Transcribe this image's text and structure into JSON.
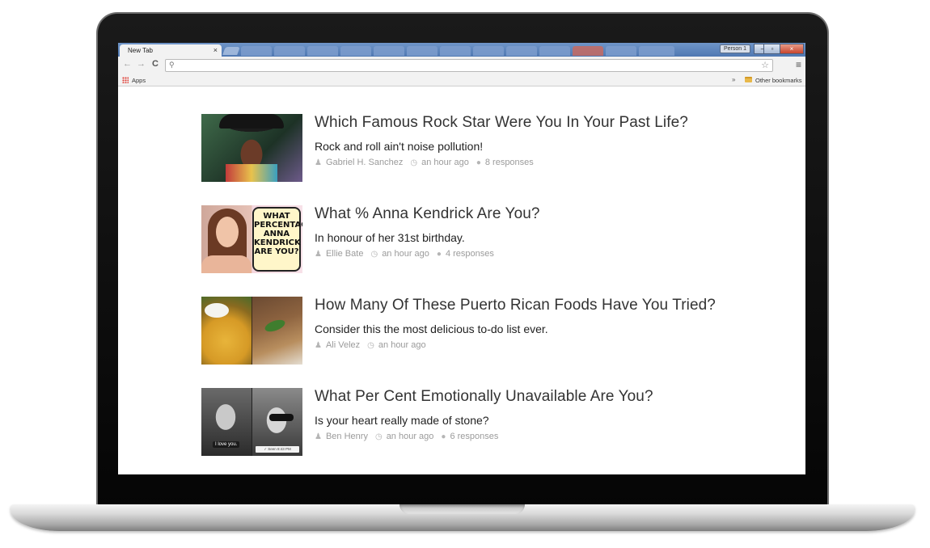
{
  "browser": {
    "active_tab_title": "New Tab",
    "tab_close_glyph": "×",
    "profile_button": "Person 1",
    "bookmarks": {
      "apps_label": "Apps",
      "overflow_glyph": "»",
      "other_bookmarks_label": "Other bookmarks"
    },
    "window_controls": {
      "minimize": "–",
      "restore": "▫",
      "close": "×"
    },
    "nav": {
      "back": "←",
      "forward": "→",
      "reload": "C",
      "menu": "≡",
      "search": "⚲",
      "star": "☆"
    }
  },
  "articles": [
    {
      "title": "Which Famous Rock Star Were You In Your Past Life?",
      "description": "Rock and roll ain't noise pollution!",
      "author": "Gabriel H. Sanchez",
      "time": "an hour ago",
      "responses": "8 responses"
    },
    {
      "title": "What % Anna Kendrick Are You?",
      "description": "In honour of her 31st birthday.",
      "author": "Ellie Bate",
      "time": "an hour ago",
      "responses": "4 responses",
      "thumb_caption": "WHAT PERCENTAGE ANNA KENDRICK ARE YOU?"
    },
    {
      "title": "How Many Of These Puerto Rican Foods Have You Tried?",
      "description": "Consider this the most delicious to-do list ever.",
      "author": "Ali Velez",
      "time": "an hour ago"
    },
    {
      "title": "What Per Cent Emotionally Unavailable Are You?",
      "description": "Is your heart really made of stone?",
      "author": "Ben Henry",
      "time": "an hour ago",
      "responses": "6 responses",
      "thumb_caption_left": "I love you.",
      "thumb_caption_right": "✓ Seen 8:43 PM"
    }
  ],
  "icons": {
    "author": "user-icon",
    "time": "clock-icon",
    "responses": "comment-icon"
  },
  "colors": {
    "title": "#333333",
    "meta": "#9b9b9b",
    "tab_strip": "#5b82bb"
  }
}
